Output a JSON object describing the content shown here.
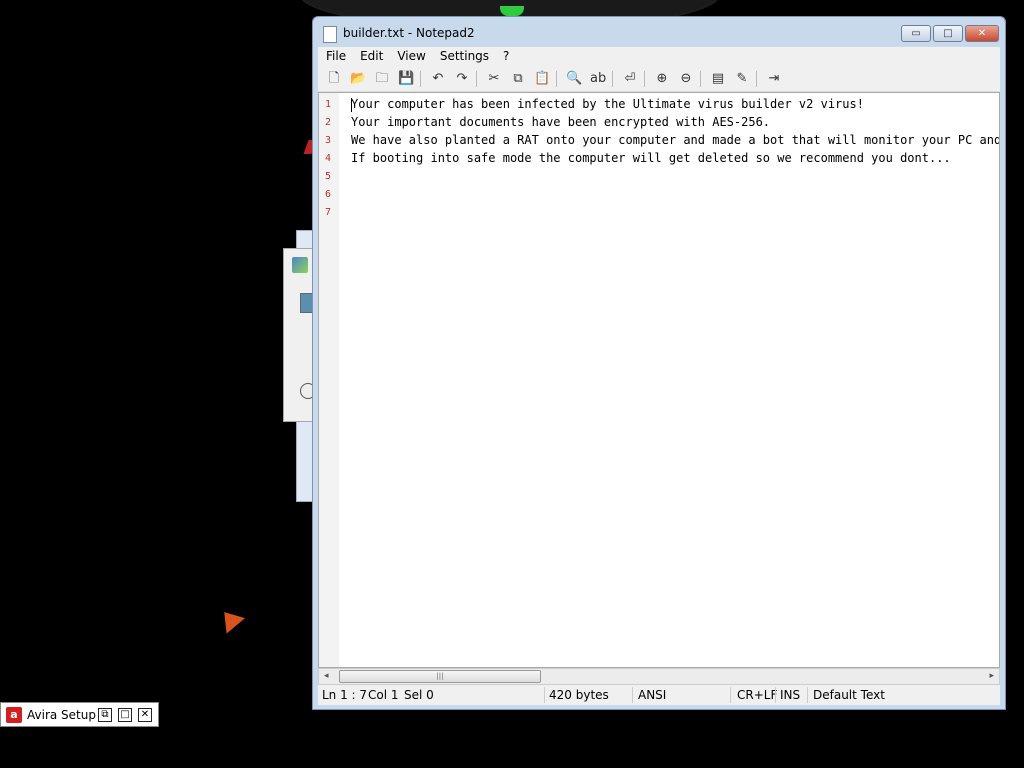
{
  "window": {
    "title": "builder.txt - Notepad2",
    "controls": {
      "minimize": "▭",
      "maximize": "□",
      "close": "✕"
    }
  },
  "menu": [
    "File",
    "Edit",
    "View",
    "Settings",
    "?"
  ],
  "toolbar": {
    "icons": [
      "new-icon",
      "open-icon",
      "browse-icon",
      "save-icon",
      "undo-icon",
      "redo-icon",
      "cut-icon",
      "copy-icon",
      "paste-icon",
      "find-icon",
      "replace-icon",
      "word-wrap-icon",
      "zoom-in-icon",
      "zoom-out-icon",
      "scheme-icon",
      "settings-icon",
      "exit-icon"
    ],
    "glyphs": [
      "🗋",
      "📂",
      "🗀",
      "💾",
      "↶",
      "↷",
      "✂",
      "⧉",
      "📋",
      "🔍",
      "ab",
      "⏎",
      "⊕",
      "⊖",
      "▤",
      "✎",
      "⇥"
    ]
  },
  "editor": {
    "line_numbers": [
      "1",
      "2",
      "3",
      "4",
      "5",
      "6",
      "7"
    ],
    "lines": [
      "Your computer has been infected by the Ultimate virus builder v2 virus!",
      "Your important documents have been encrypted with AES-256.",
      "We have also planted a RAT onto your computer and made a bot that will monitor your PC and if",
      "If booting into safe mode the computer will get deleted so we recommend you dont...",
      "",
      "",
      ""
    ]
  },
  "scrollbar": {
    "left": "◂",
    "right": "▸",
    "thumb_grip": "|||"
  },
  "status": {
    "ln": "Ln 1 : 7",
    "col": "Col 1",
    "sel": "Sel 0",
    "size": "420 bytes",
    "encoding": "ANSI",
    "eol": "CR+LF",
    "ins": "INS",
    "scheme": "Default Text"
  },
  "taskbar": {
    "label": "Avira Setup",
    "restore": "⧉",
    "maximize": "□",
    "close": "✕"
  },
  "colors": {
    "line_number": "#c03030",
    "close_button": "#c84a32",
    "avira_red": "#d21f1f"
  }
}
